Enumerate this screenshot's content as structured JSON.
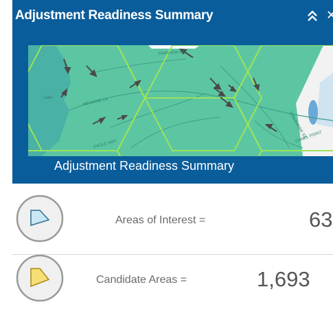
{
  "widget": {
    "title": "Adjustment Readiness Summary",
    "collapse_icon": "double-chevron-up-icon",
    "close_icon": "close-icon",
    "close_glyph": "✕",
    "header_color": "#0a5d9b"
  },
  "map_thumbnail": {
    "caption": "Adjustment Readiness Summary",
    "fill_color": "#5cc6a3",
    "hex_outline_color": "#9be35a",
    "road_labels": [
      "FAIRVIEW RD",
      "MEADOW LN",
      "TOMAHAWK ST",
      "EAGLE WAY",
      "CAMEL POINT"
    ],
    "water_labels": [
      "Lake"
    ]
  },
  "stats": [
    {
      "label": "Areas of Interest =",
      "value": "63",
      "icon": "polygon-light-blue-icon",
      "icon_fill": "#c9e7f4"
    },
    {
      "label": "Candidate Areas =",
      "value": "1,693",
      "icon": "polygon-yellow-icon",
      "icon_fill": "#f7df76"
    }
  ]
}
